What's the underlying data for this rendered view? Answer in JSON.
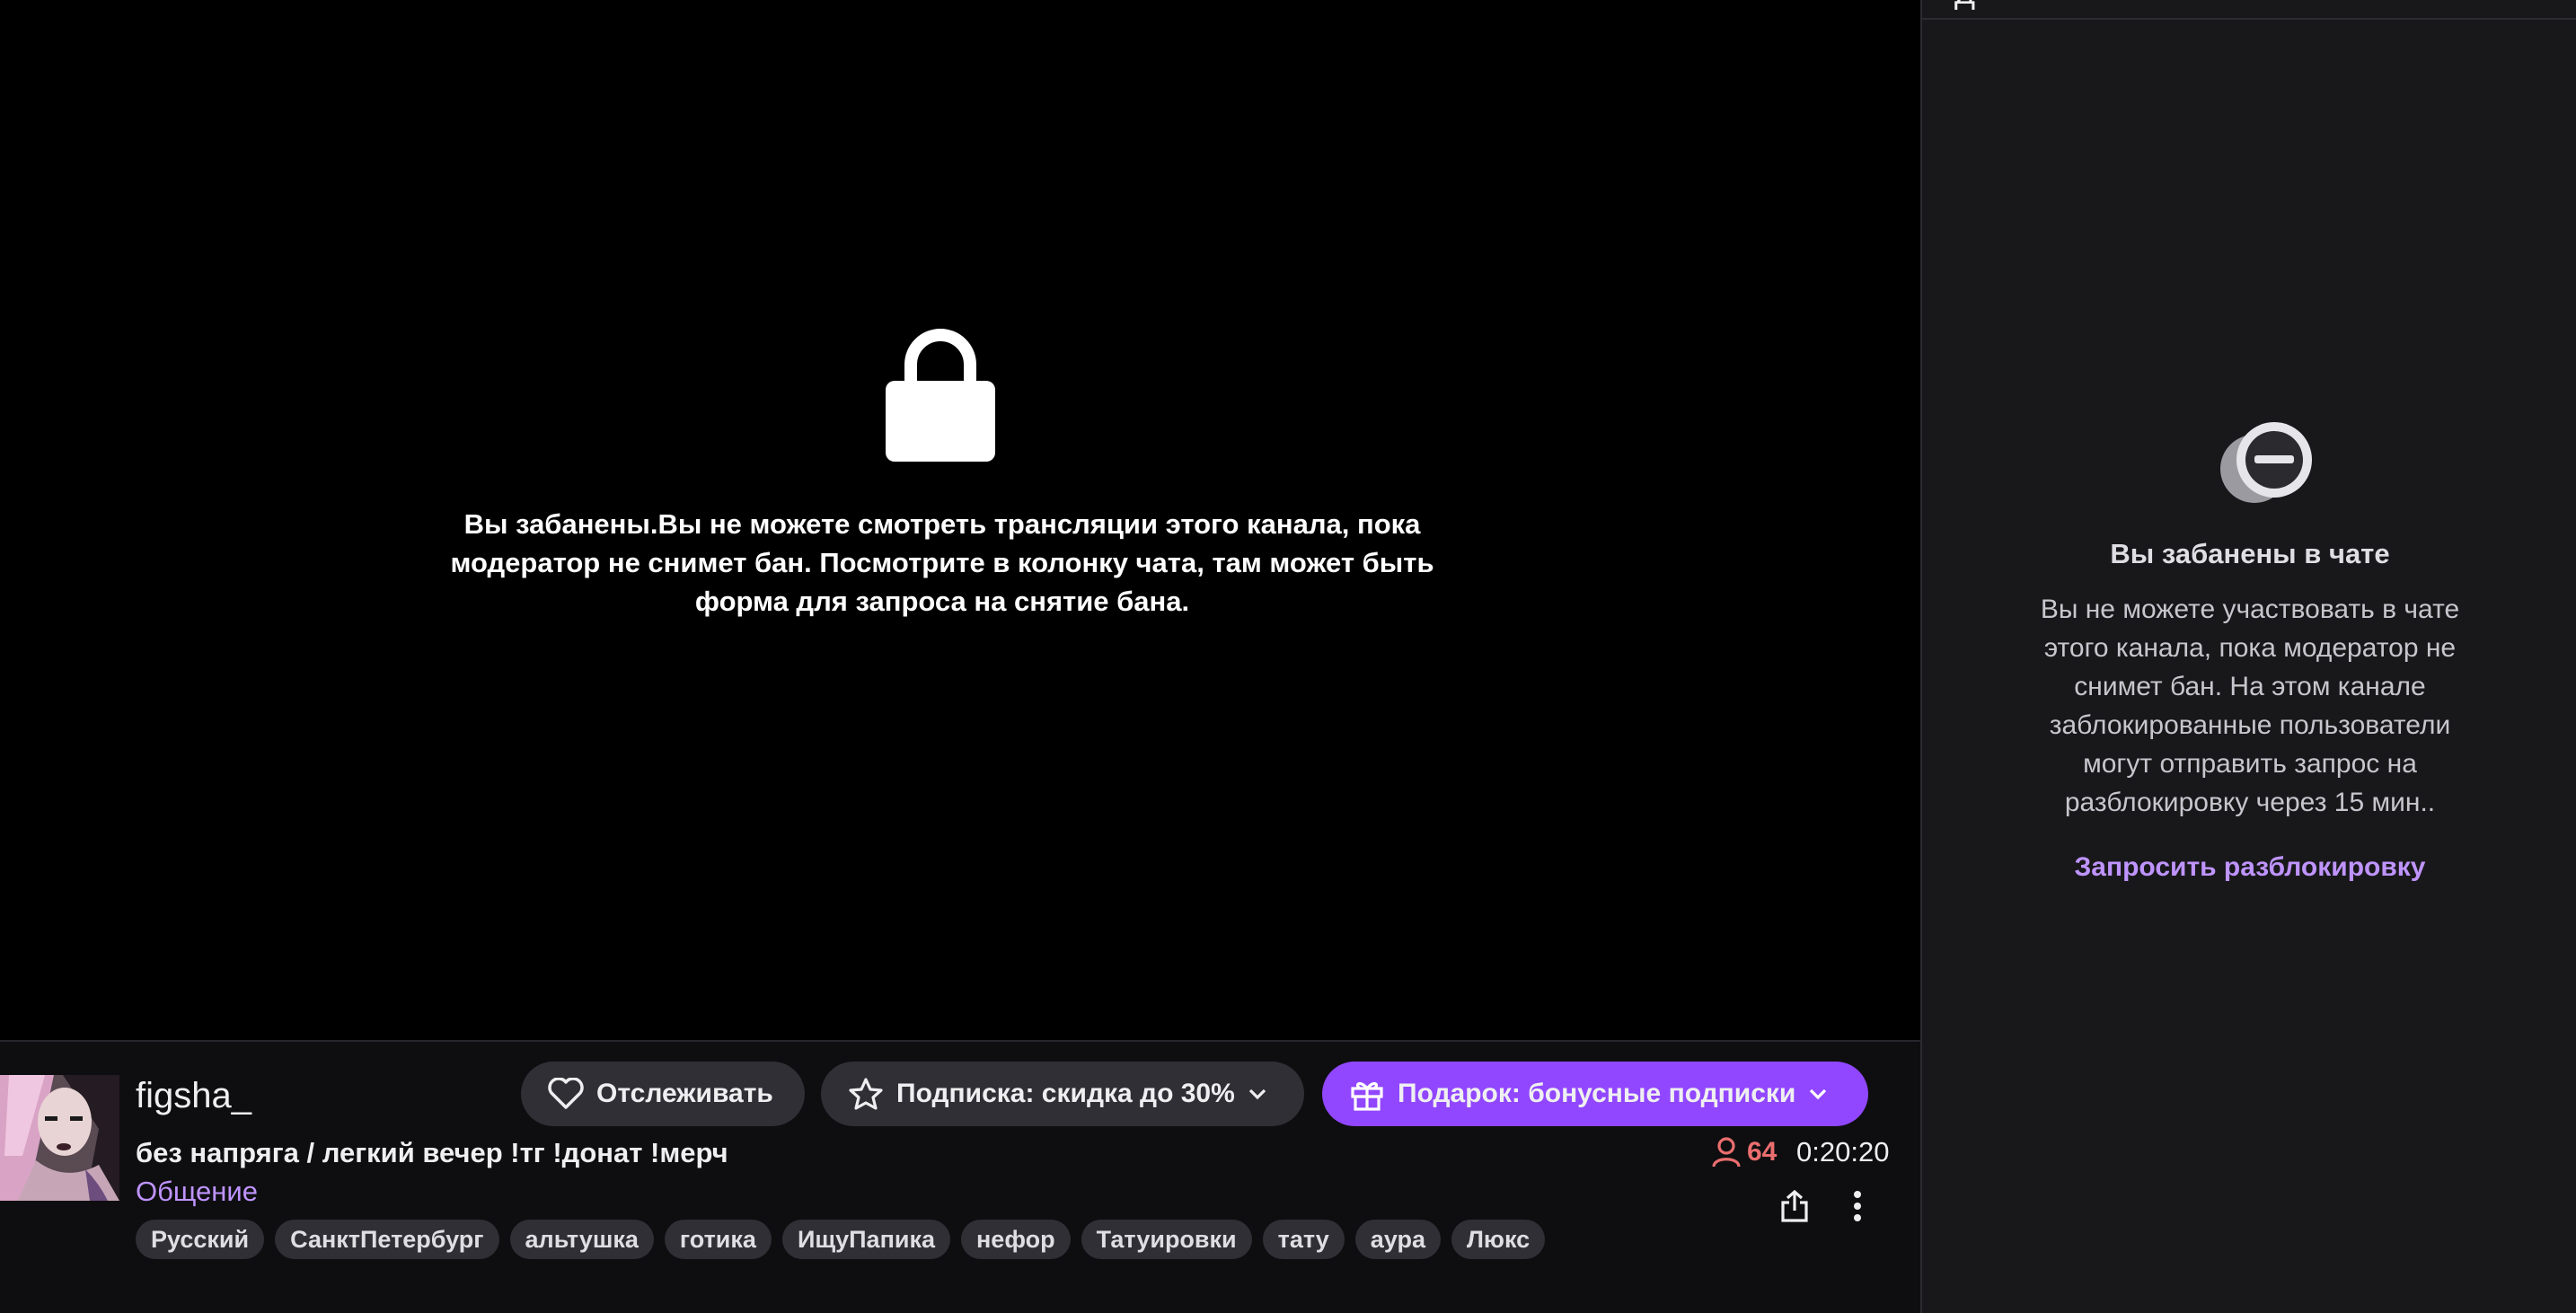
{
  "player": {
    "ban_message": "Вы забанены.Вы не можете смотреть трансляции этого канала, пока модератор не снимет бан. Посмотрите в колонку чата, там может быть форма для запроса на снятие бана."
  },
  "channel": {
    "name": "figsha_",
    "stream_title": "без напряга / легкий вечер !тг !донат !мерч",
    "category": "Общение",
    "viewers": "64",
    "uptime": "0:20:20",
    "follow_label": "Отслеживать",
    "subscribe_label": "Подписка: скидка до 30%",
    "gift_label": "Подарок: бонусные подписки",
    "tags": [
      "Русский",
      "СанктПетербург",
      "альтушка",
      "готика",
      "ИщуПапика",
      "нефор",
      "Татуировки",
      "тату",
      "аура",
      "Люкс"
    ]
  },
  "chat": {
    "header_glyph": "Д",
    "ban_title": "Вы забанены в чате",
    "ban_text": "Вы не можете участвовать в чате этого канала, пока модератор не снимет бан. На этом канале заблокированные пользователи могут отправить запрос на разблокировку через 15 мин..",
    "unban_link": "Запросить разблокировку"
  },
  "colors": {
    "accent": "#9147ff",
    "link": "#bf94ff",
    "viewer_count": "#eb6e6e",
    "background": "#0e0e10",
    "chat_background": "#18181b"
  },
  "icons": {
    "lock": "lock-icon",
    "heart": "heart-icon",
    "star": "star-icon",
    "gift": "gift-icon",
    "chevron": "chevron-down-icon",
    "viewer": "person-icon",
    "share": "share-icon",
    "more": "more-vertical-icon",
    "chat_ban": "ban-icon"
  }
}
